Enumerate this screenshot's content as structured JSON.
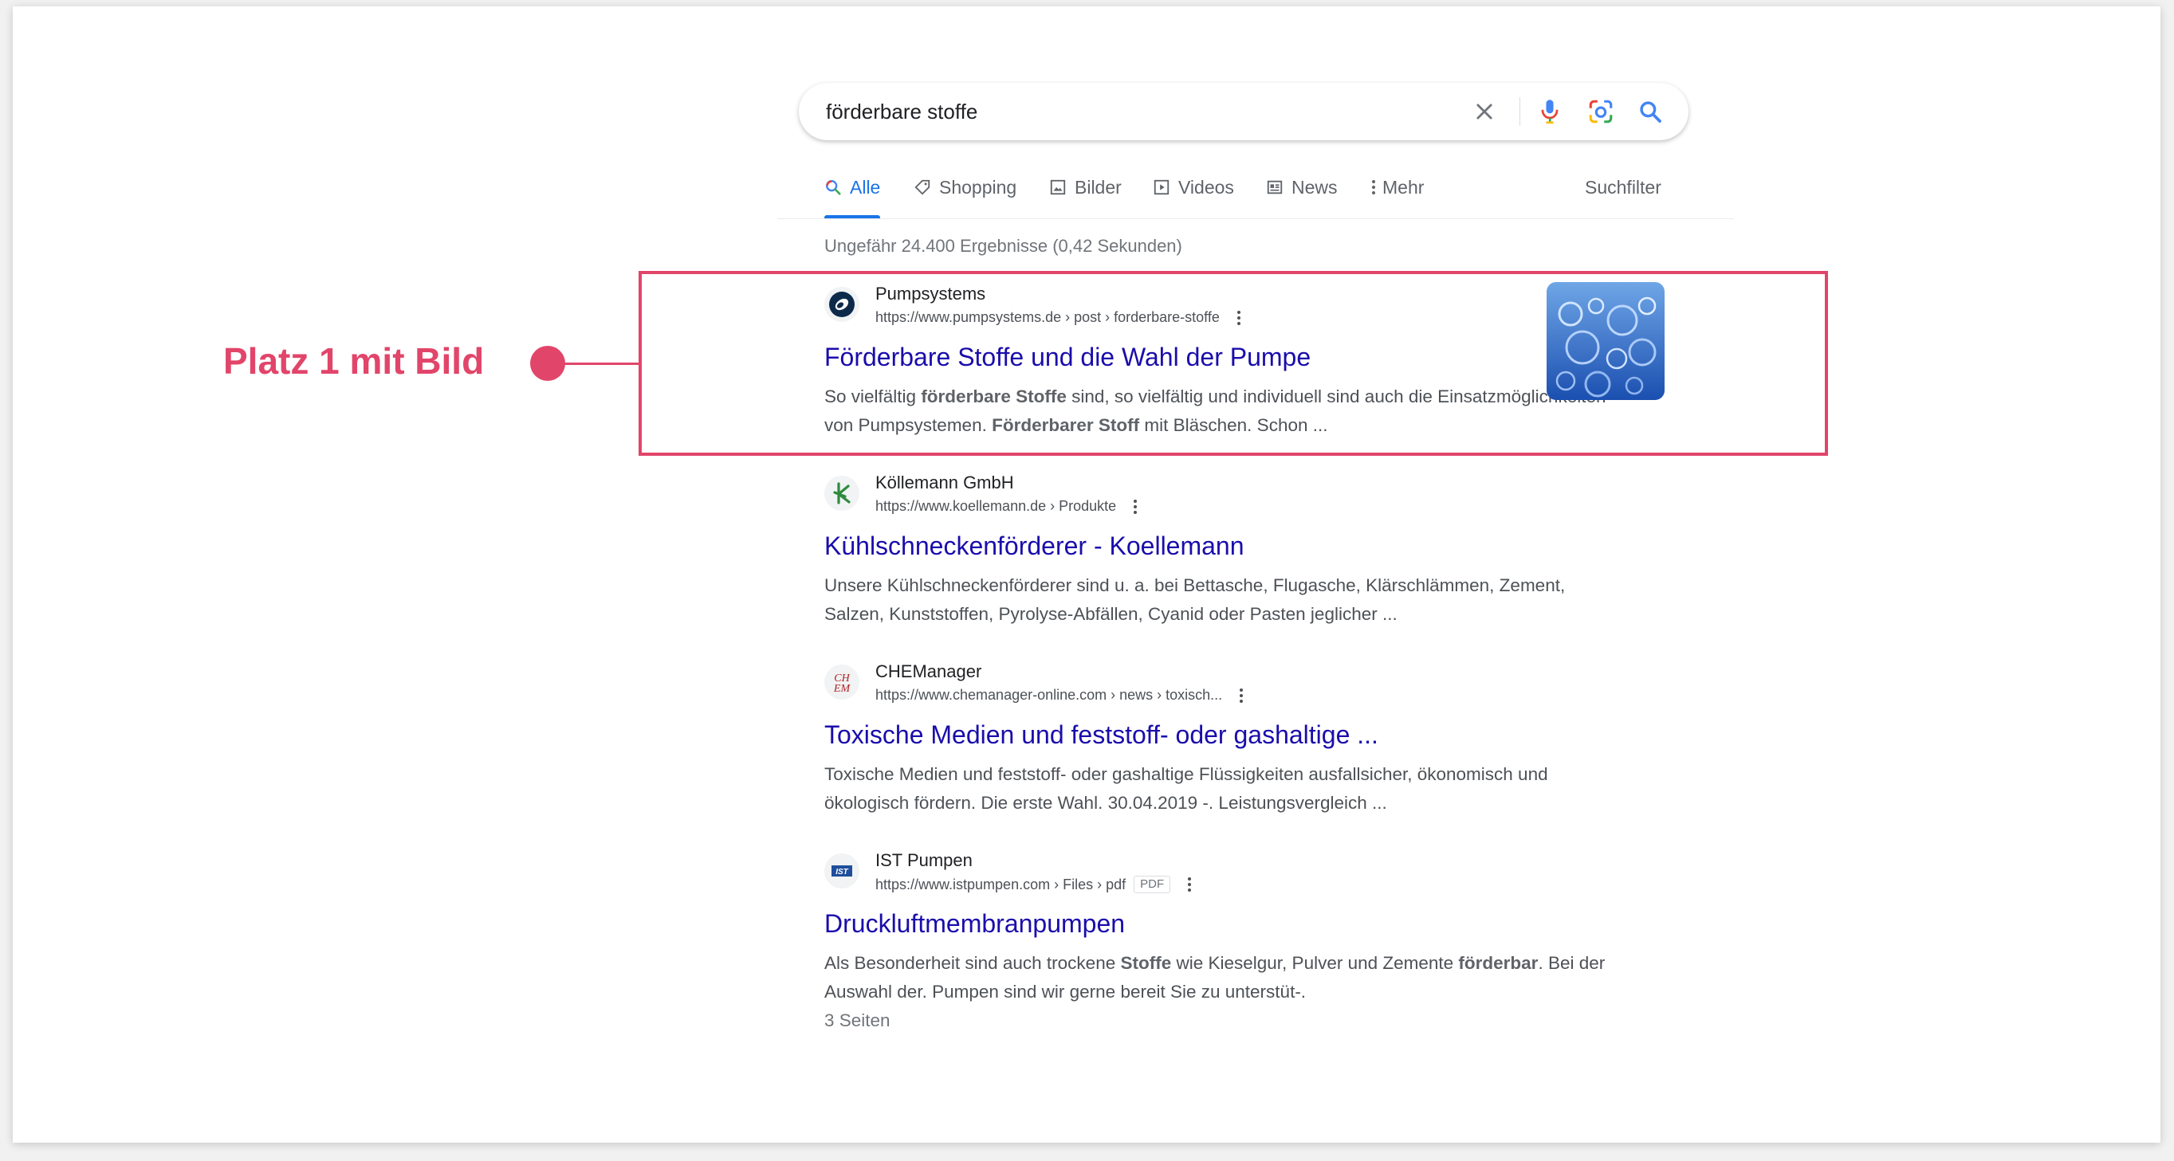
{
  "search": {
    "query": "förderbare stoffe"
  },
  "icons": {
    "clear": "close-icon",
    "voice": "microphone-icon",
    "lens": "camera-lens-icon",
    "search": "search-icon"
  },
  "tabs": [
    {
      "label": "Alle",
      "icon": "search-icon",
      "active": true
    },
    {
      "label": "Shopping",
      "icon": "tag-icon",
      "active": false
    },
    {
      "label": "Bilder",
      "icon": "image-icon",
      "active": false
    },
    {
      "label": "Videos",
      "icon": "play-icon",
      "active": false
    },
    {
      "label": "News",
      "icon": "newspaper-icon",
      "active": false
    },
    {
      "label": "Mehr",
      "icon": "more-vertical-icon",
      "active": false
    }
  ],
  "filter_label": "Suchfilter",
  "stats": "Ungefähr 24.400 Ergebnisse (0,42 Sekunden)",
  "results": [
    {
      "site": "Pumpsystems",
      "url": "https://www.pumpsystems.de › post › forderbare-stoffe",
      "title": "Förderbare Stoffe und die Wahl der Pumpe",
      "snippet_html": "So vielfältig <b>förderbare Stoffe</b> sind, so vielfältig und individuell sind auch die Einsatzmöglichkeiten von Pumpsystemen. <b>Förderbarer Stoff</b> mit Bläschen. Schon ..."
    },
    {
      "site": "Köllemann GmbH",
      "url": "https://www.koellemann.de › Produkte",
      "title": "Kühlschneckenförderer - Koellemann",
      "snippet_html": "Unsere Kühlschneckenförderer sind u. a. bei Bettasche, Flugasche, Klärschlämmen, Zement, Salzen, Kunststoffen, Pyrolyse-Abfällen, Cyanid oder Pasten jeglicher ..."
    },
    {
      "site": "CHEManager",
      "url": "https://www.chemanager-online.com › news › toxisch...",
      "title": "Toxische Medien und feststoff- oder gashaltige ...",
      "snippet_html": "Toxische Medien und feststoff- oder gashaltige Flüssigkeiten ausfallsicher, ökonomisch und ökologisch fördern. Die erste Wahl. 30.04.2019 -. Leistungsvergleich ..."
    },
    {
      "site": "IST Pumpen",
      "url": "https://www.istpumpen.com › Files › pdf",
      "badge": "PDF",
      "title": "Druckluftmembranpumpen",
      "snippet_html": "Als Besonderheit sind auch trockene <b>Stoffe</b> wie Kieselgur, Pulver und Zemente <b>förderbar</b>. Bei der Auswahl der. Pumpen sind wir gerne bereit Sie zu unterstüt-.",
      "extra": "3 Seiten"
    }
  ],
  "annotation": {
    "label": "Platz 1 mit Bild"
  },
  "colors": {
    "accent": "#1a73e8",
    "link": "#1a0dab",
    "annotation": "#e2456a"
  }
}
